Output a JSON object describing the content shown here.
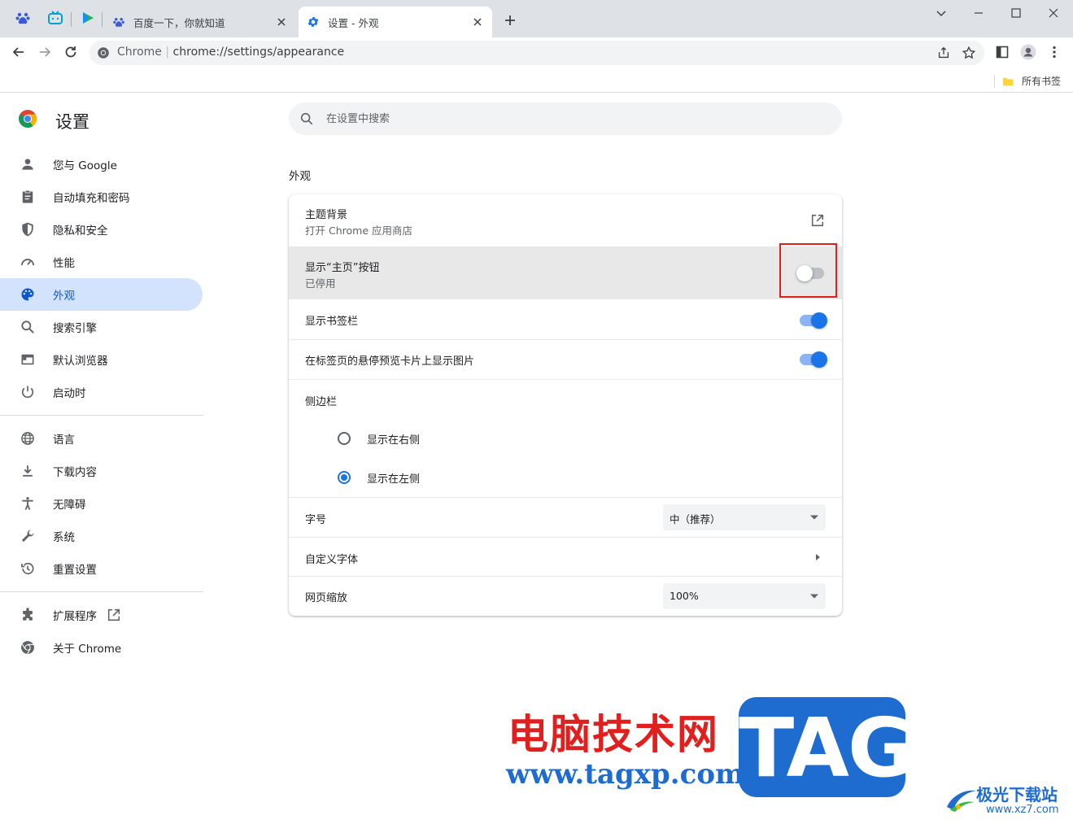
{
  "browser": {
    "tabs": [
      {
        "title": "百度一下，你就知道"
      },
      {
        "title": "设置 - 外观",
        "active": true
      }
    ],
    "omnibox": {
      "site": "Chrome",
      "url": "chrome://settings/appearance"
    },
    "bookmarks_label": "所有书签"
  },
  "settings": {
    "title": "设置",
    "search_placeholder": "在设置中搜索",
    "nav": [
      {
        "label": "您与 Google",
        "icon": "person-icon"
      },
      {
        "label": "自动填充和密码",
        "icon": "clipboard-icon"
      },
      {
        "label": "隐私和安全",
        "icon": "shield-icon"
      },
      {
        "label": "性能",
        "icon": "speedometer-icon"
      },
      {
        "label": "外观",
        "icon": "palette-icon",
        "active": true
      },
      {
        "label": "搜索引擎",
        "icon": "search-icon"
      },
      {
        "label": "默认浏览器",
        "icon": "browser-icon"
      },
      {
        "label": "启动时",
        "icon": "power-icon"
      },
      {
        "label": "语言",
        "icon": "globe-icon"
      },
      {
        "label": "下载内容",
        "icon": "download-icon"
      },
      {
        "label": "无障碍",
        "icon": "accessibility-icon"
      },
      {
        "label": "系统",
        "icon": "wrench-icon"
      },
      {
        "label": "重置设置",
        "icon": "history-icon"
      },
      {
        "label": "扩展程序",
        "icon": "puzzle-icon"
      },
      {
        "label": "关于 Chrome",
        "icon": "chrome-icon"
      }
    ],
    "section_title": "外观",
    "appearance": {
      "theme_title": "主题背景",
      "theme_sub": "打开 Chrome 应用商店",
      "home_title": "显示“主页”按钮",
      "home_sub": "已停用",
      "home_enabled": false,
      "bookmarks_bar_title": "显示书签栏",
      "bookmarks_bar_enabled": true,
      "hover_preview_title": "在标签页的悬停预览卡片上显示图片",
      "hover_preview_enabled": true,
      "side_panel_title": "侧边栏",
      "side_panel_right": "显示在右侧",
      "side_panel_left": "显示在左侧",
      "side_panel_selected": "left",
      "font_size_title": "字号",
      "font_size_value": "中（推荐）",
      "custom_fonts_title": "自定义字体",
      "zoom_title": "网页缩放",
      "zoom_value": "100%"
    }
  },
  "watermark": {
    "cn": "电脑技术网",
    "url": "www.tagxp.com",
    "tag": "TAG",
    "logo_cn": "极光下载站",
    "logo_url": "www.xz7.com"
  },
  "colors": {
    "accent": "#1a73e8",
    "nav_active_bg": "#d3e3fd",
    "highlight": "#e0201f"
  }
}
